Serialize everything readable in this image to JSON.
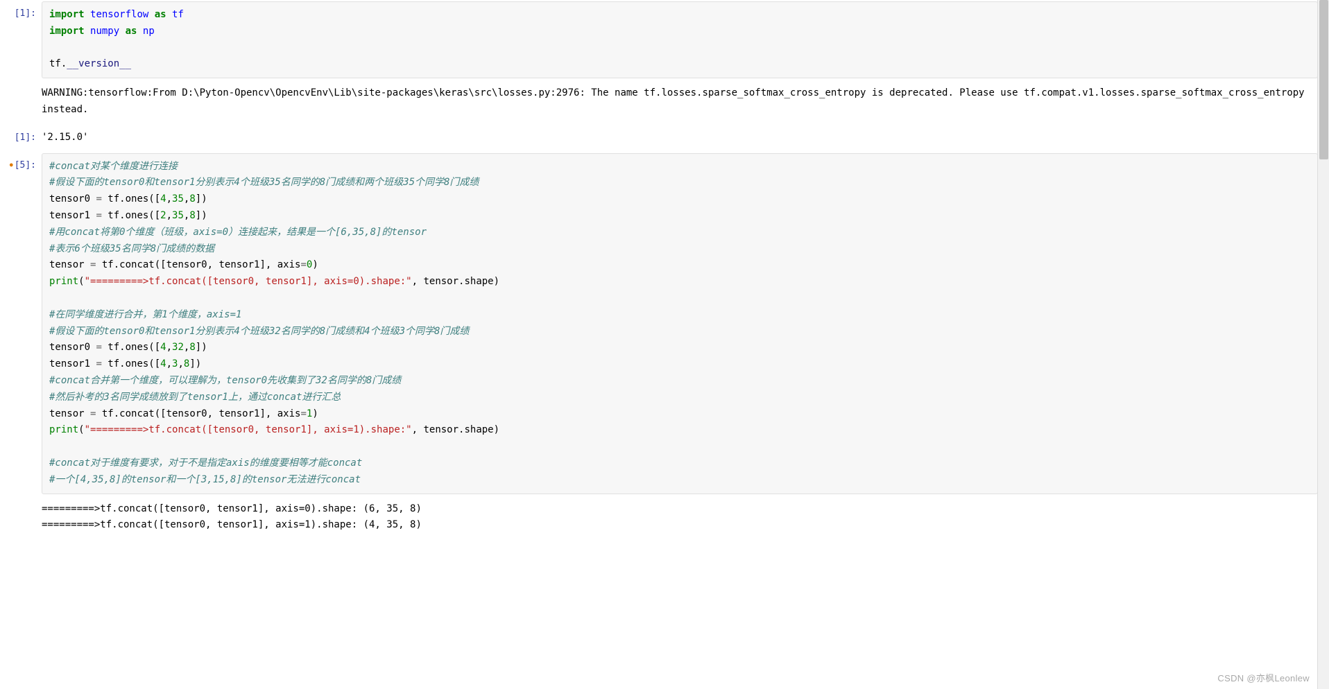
{
  "cells": {
    "c1": {
      "prompt": "[1]:",
      "out_prompt": "[1]:",
      "input_html": "<span class=\"kw\">import </span><span class=\"nn\">tensorflow</span> <span class=\"kw\">as</span> <span class=\"nn\">tf</span>\n<span class=\"kw\">import </span><span class=\"nn\">numpy</span> <span class=\"kw\">as</span> <span class=\"nn\">np</span>\n\ntf.<span class=\"version\">__version__</span>",
      "warning": "WARNING:tensorflow:From D:\\Pyton-Opencv\\OpencvEnv\\Lib\\site-packages\\keras\\src\\losses.py:2976: The name tf.losses.sparse_softmax_cross_entropy is deprecated. Please use tf.compat.v1.losses.sparse_softmax_cross_entropy instead.\n",
      "result": "'2.15.0'"
    },
    "c2": {
      "prompt": "[5]:",
      "input_html": "<span class=\"cm\">#concat对某个维度进行连接</span>\n<span class=\"cm\">#假设下面的tensor0和tensor1分别表示4个班级35名同学的8门成绩和两个班级35个同学8门成绩</span>\ntensor0 <span class=\"op\">=</span> tf.ones([<span class=\"num\">4</span>,<span class=\"num\">35</span>,<span class=\"num\">8</span>])\ntensor1 <span class=\"op\">=</span> tf.ones([<span class=\"num\">2</span>,<span class=\"num\">35</span>,<span class=\"num\">8</span>])\n<span class=\"cm\">#用concat将第0个维度（班级，axis=0）连接起来，结果是一个[6,35,8]的tensor</span>\n<span class=\"cm\">#表示6个班级35名同学8门成绩的数据</span>\ntensor <span class=\"op\">=</span> tf.concat([tensor0, tensor1], axis<span class=\"op\">=</span><span class=\"num\">0</span>)\n<span class=\"pr\">print</span>(<span class=\"str\">\"=========&gt;tf.concat([tensor0, tensor1], axis=0).shape:\"</span>, tensor.shape)\n\n<span class=\"cm\">#在同学维度进行合并，第1个维度，axis=1</span>\n<span class=\"cm\">#假设下面的tensor0和tensor1分别表示4个班级32名同学的8门成绩和4个班级3个同学8门成绩</span>\ntensor0 <span class=\"op\">=</span> tf.ones([<span class=\"num\">4</span>,<span class=\"num\">32</span>,<span class=\"num\">8</span>])\ntensor1 <span class=\"op\">=</span> tf.ones([<span class=\"num\">4</span>,<span class=\"num\">3</span>,<span class=\"num\">8</span>])\n<span class=\"cm\">#concat合并第一个维度，可以理解为，tensor0先收集到了32名同学的8门成绩</span>\n<span class=\"cm\">#然后补考的3名同学成绩放到了tensor1上，通过concat进行汇总</span>\ntensor <span class=\"op\">=</span> tf.concat([tensor0, tensor1], axis<span class=\"op\">=</span><span class=\"num\">1</span>)\n<span class=\"pr\">print</span>(<span class=\"str\">\"=========&gt;tf.concat([tensor0, tensor1], axis=1).shape:\"</span>, tensor.shape)\n\n<span class=\"cm\">#concat对于维度有要求，对于不是指定axis的维度要相等才能concat</span>\n<span class=\"cm\">#一个[4,35,8]的tensor和一个[3,15,8]的tensor无法进行concat</span>",
      "stdout": "=========>tf.concat([tensor0, tensor1], axis=0).shape: (6, 35, 8)\n=========>tf.concat([tensor0, tensor1], axis=1).shape: (4, 35, 8)"
    }
  },
  "watermark": "CSDN @亦枫Leonlew"
}
